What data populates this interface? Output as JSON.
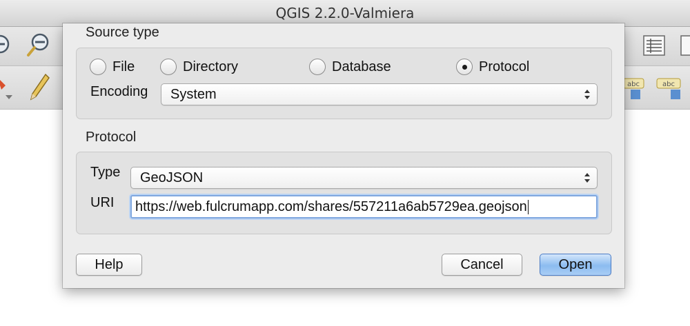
{
  "window": {
    "title": "QGIS 2.2.0-Valmiera"
  },
  "toolbar": {
    "zoom_in_icon": "zoom-in-icon",
    "zoom_out_icon": "zoom-out-icon",
    "pencil_icon": "pencil-icon",
    "label_icon_text": "abc"
  },
  "dialog": {
    "source_type": {
      "title": "Source type",
      "options": [
        "File",
        "Directory",
        "Database",
        "Protocol"
      ],
      "selected": "Protocol",
      "encoding_label": "Encoding",
      "encoding_value": "System"
    },
    "protocol": {
      "title": "Protocol",
      "type_label": "Type",
      "type_value": "GeoJSON",
      "uri_label": "URI",
      "uri_value": "https://web.fulcrumapp.com/shares/557211a6ab5729ea.geojson"
    },
    "buttons": {
      "help": "Help",
      "cancel": "Cancel",
      "open": "Open"
    }
  },
  "colors": {
    "default_button": "#8cbcf0",
    "focus_ring": "#7fa7df"
  }
}
